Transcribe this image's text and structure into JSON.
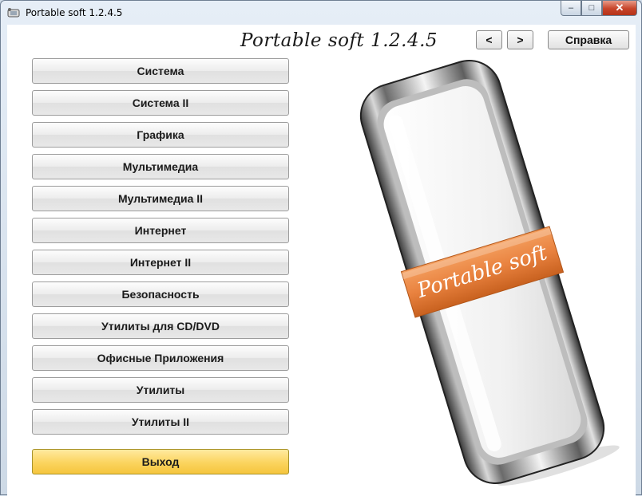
{
  "window": {
    "title": "Portable soft 1.2.4.5",
    "minimize_glyph": "–",
    "maximize_glyph": "□",
    "close_glyph": "✕"
  },
  "header": {
    "heading": "Portable soft 1.2.4.5",
    "prev_label": "<",
    "next_label": ">",
    "help_label": "Справка"
  },
  "menu": {
    "items": [
      {
        "label": "Система"
      },
      {
        "label": "Система II"
      },
      {
        "label": "Графика"
      },
      {
        "label": "Мультимедиа"
      },
      {
        "label": "Мультимедиа II"
      },
      {
        "label": "Интернет"
      },
      {
        "label": "Интернет II"
      },
      {
        "label": "Безопасность"
      },
      {
        "label": "Утилиты для CD/DVD"
      },
      {
        "label": "Офисные Приложения"
      },
      {
        "label": "Утилиты"
      },
      {
        "label": "Утилиты II"
      }
    ],
    "exit_label": "Выход"
  },
  "illustration": {
    "band_text": "Portable soft",
    "band_color": "#e9823f"
  }
}
